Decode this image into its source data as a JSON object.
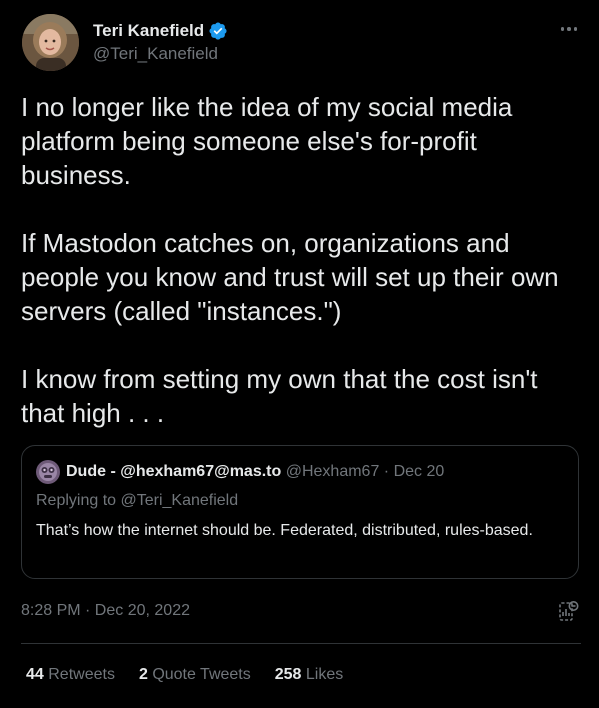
{
  "author": {
    "name": "Teri Kanefield",
    "handle": "@Teri_Kanefield",
    "verified": true,
    "avatar_icon": "profile-photo"
  },
  "tweet": {
    "text": "I no longer like the idea of my social media platform being someone else's for-profit business.\n\nIf Mastodon catches on, organizations and people you know and trust will set up their own servers (called \"instances.\")\n\nI know from setting my own that the cost isn't that high . . ."
  },
  "quoted_tweet": {
    "name": "Dude - @hexham67@mas.to",
    "handle": "@Hexham67",
    "separator": "·",
    "date": "Dec 20",
    "replying_to": "Replying to @Teri_Kanefield",
    "text": "That’s how the internet should be. Federated, distributed, rules-based."
  },
  "meta": {
    "timestamp": "8:28 PM · Dec 20, 2022"
  },
  "stats": {
    "retweets_count": "44",
    "retweets_label": "Retweets",
    "quotes_count": "2",
    "quotes_label": "Quote Tweets",
    "likes_count": "258",
    "likes_label": "Likes"
  },
  "colors": {
    "background": "#000000",
    "text": "#e7e9ea",
    "muted": "#71767b",
    "border": "#2f3336",
    "verified": "#1d9bf0"
  }
}
